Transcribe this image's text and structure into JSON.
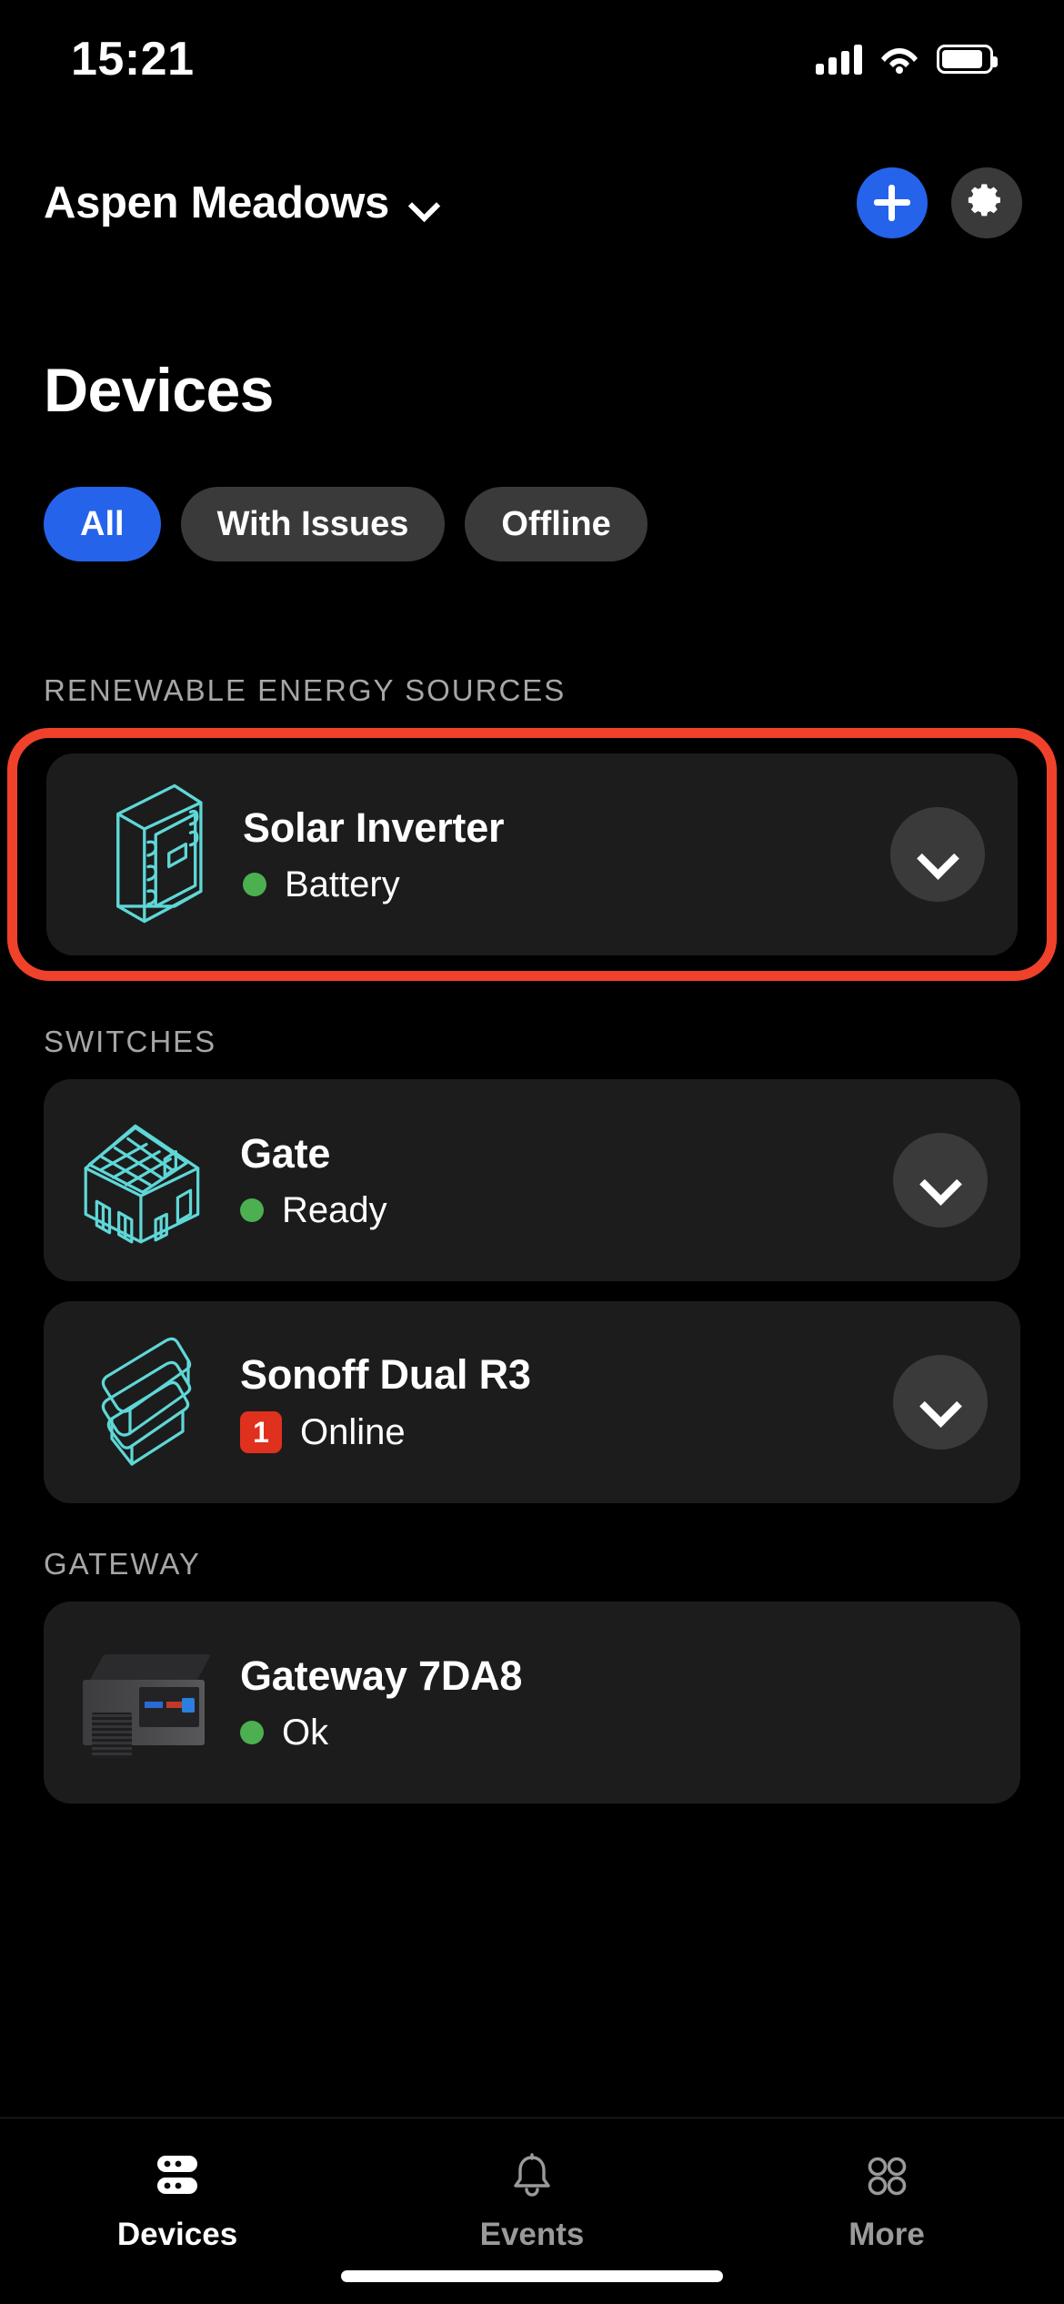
{
  "status_bar": {
    "time": "15:21",
    "icons": [
      "cellular-signal-icon",
      "wifi-icon",
      "battery-icon"
    ]
  },
  "header": {
    "site_name": "Aspen Meadows",
    "site_chevron_icon": "chevron-down-icon",
    "add_button_icon": "plus-icon",
    "settings_button_icon": "gear-icon"
  },
  "page": {
    "title": "Devices"
  },
  "filters": [
    {
      "label": "All",
      "active": true
    },
    {
      "label": "With Issues",
      "active": false
    },
    {
      "label": "Offline",
      "active": false
    }
  ],
  "sections": [
    {
      "title": "RENEWABLE ENERGY SOURCES",
      "devices": [
        {
          "name": "Solar Inverter",
          "status": "Battery",
          "status_indicator": "green-dot",
          "badge": "",
          "icon": "solar-inverter-icon",
          "chevron_icon": "chevron-down-icon",
          "highlighted": true
        }
      ]
    },
    {
      "title": "SWITCHES",
      "devices": [
        {
          "name": "Gate",
          "status": "Ready",
          "status_indicator": "green-dot",
          "badge": "",
          "icon": "house-solar-panel-icon",
          "chevron_icon": "chevron-down-icon",
          "highlighted": false
        },
        {
          "name": "Sonoff Dual R3",
          "status": "Online",
          "status_indicator": "red-badge",
          "badge": "1",
          "icon": "switch-module-icon",
          "chevron_icon": "chevron-down-icon",
          "highlighted": false
        }
      ]
    },
    {
      "title": "GATEWAY",
      "devices": [
        {
          "name": "Gateway 7DA8",
          "status": "Ok",
          "status_indicator": "green-dot",
          "badge": "",
          "icon": "gateway-device-photo",
          "chevron_icon": "",
          "highlighted": false
        }
      ]
    }
  ],
  "tabbar": [
    {
      "label": "Devices",
      "icon": "server-icon",
      "active": true
    },
    {
      "label": "Events",
      "icon": "bell-icon",
      "active": false
    },
    {
      "label": "More",
      "icon": "grid-dots-icon",
      "active": false
    }
  ],
  "colors": {
    "accent_blue": "#2563eb",
    "highlight_red": "#f0412a",
    "status_green": "#4caf50",
    "badge_red": "#e0301e",
    "icon_cyan": "#5fd7d7",
    "card_bg": "#1c1c1c",
    "chip_bg": "#3a3a3a"
  }
}
